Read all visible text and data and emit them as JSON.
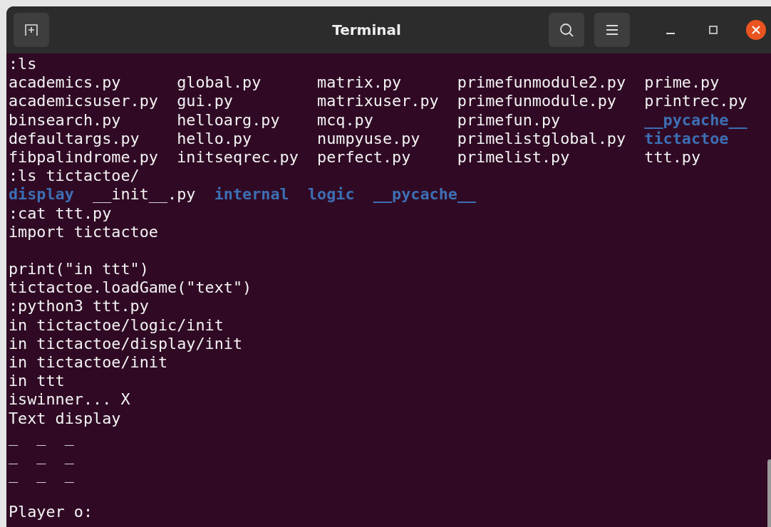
{
  "window": {
    "title": "Terminal"
  },
  "lines": [
    {
      "kind": "text",
      "text": ":ls"
    },
    {
      "kind": "grid",
      "entries": [
        {
          "name": "academics.py",
          "directory": false
        },
        {
          "name": "global.py",
          "directory": false
        },
        {
          "name": "matrix.py",
          "directory": false
        },
        {
          "name": "primefunmodule2.py",
          "directory": false
        },
        {
          "name": "prime.py",
          "directory": false
        }
      ]
    },
    {
      "kind": "grid",
      "entries": [
        {
          "name": "academicsuser.py",
          "directory": false
        },
        {
          "name": "gui.py",
          "directory": false
        },
        {
          "name": "matrixuser.py",
          "directory": false
        },
        {
          "name": "primefunmodule.py",
          "directory": false
        },
        {
          "name": "printrec.py",
          "directory": false
        }
      ]
    },
    {
      "kind": "grid",
      "entries": [
        {
          "name": "binsearch.py",
          "directory": false
        },
        {
          "name": "helloarg.py",
          "directory": false
        },
        {
          "name": "mcq.py",
          "directory": false
        },
        {
          "name": "primefun.py",
          "directory": false
        },
        {
          "name": "__pycache__",
          "directory": true
        }
      ]
    },
    {
      "kind": "grid",
      "entries": [
        {
          "name": "defaultargs.py",
          "directory": false
        },
        {
          "name": "hello.py",
          "directory": false
        },
        {
          "name": "numpyuse.py",
          "directory": false
        },
        {
          "name": "primelistglobal.py",
          "directory": false
        },
        {
          "name": "tictactoe",
          "directory": true
        }
      ]
    },
    {
      "kind": "grid",
      "entries": [
        {
          "name": "fibpalindrome.py",
          "directory": false
        },
        {
          "name": "initseqrec.py",
          "directory": false
        },
        {
          "name": "perfect.py",
          "directory": false
        },
        {
          "name": "primelist.py",
          "directory": false
        },
        {
          "name": "ttt.py",
          "directory": false
        }
      ]
    },
    {
      "kind": "text",
      "text": ":ls tictactoe/"
    },
    {
      "kind": "inline",
      "entries": [
        {
          "name": "display",
          "directory": true
        },
        {
          "name": "__init__.py",
          "directory": false
        },
        {
          "name": "internal",
          "directory": true
        },
        {
          "name": "logic",
          "directory": true
        },
        {
          "name": "__pycache__",
          "directory": true
        }
      ]
    },
    {
      "kind": "text",
      "text": ":cat ttt.py"
    },
    {
      "kind": "text",
      "text": "import tictactoe"
    },
    {
      "kind": "blank"
    },
    {
      "kind": "text",
      "text": "print(\"in ttt\")"
    },
    {
      "kind": "text",
      "text": "tictactoe.loadGame(\"text\")"
    },
    {
      "kind": "text",
      "text": ":python3 ttt.py"
    },
    {
      "kind": "text",
      "text": "in tictactoe/logic/init"
    },
    {
      "kind": "text",
      "text": "in tictactoe/display/init"
    },
    {
      "kind": "text",
      "text": "in tictactoe/init"
    },
    {
      "kind": "text",
      "text": "in ttt"
    },
    {
      "kind": "text",
      "text": "iswinner... X"
    },
    {
      "kind": "text",
      "text": "Text display"
    },
    {
      "kind": "text",
      "text": "_  _  _"
    },
    {
      "kind": "text",
      "text": "_  _  _"
    },
    {
      "kind": "text",
      "text": "_  _  _"
    },
    {
      "kind": "blank"
    },
    {
      "kind": "text",
      "text": "Player o:"
    }
  ]
}
